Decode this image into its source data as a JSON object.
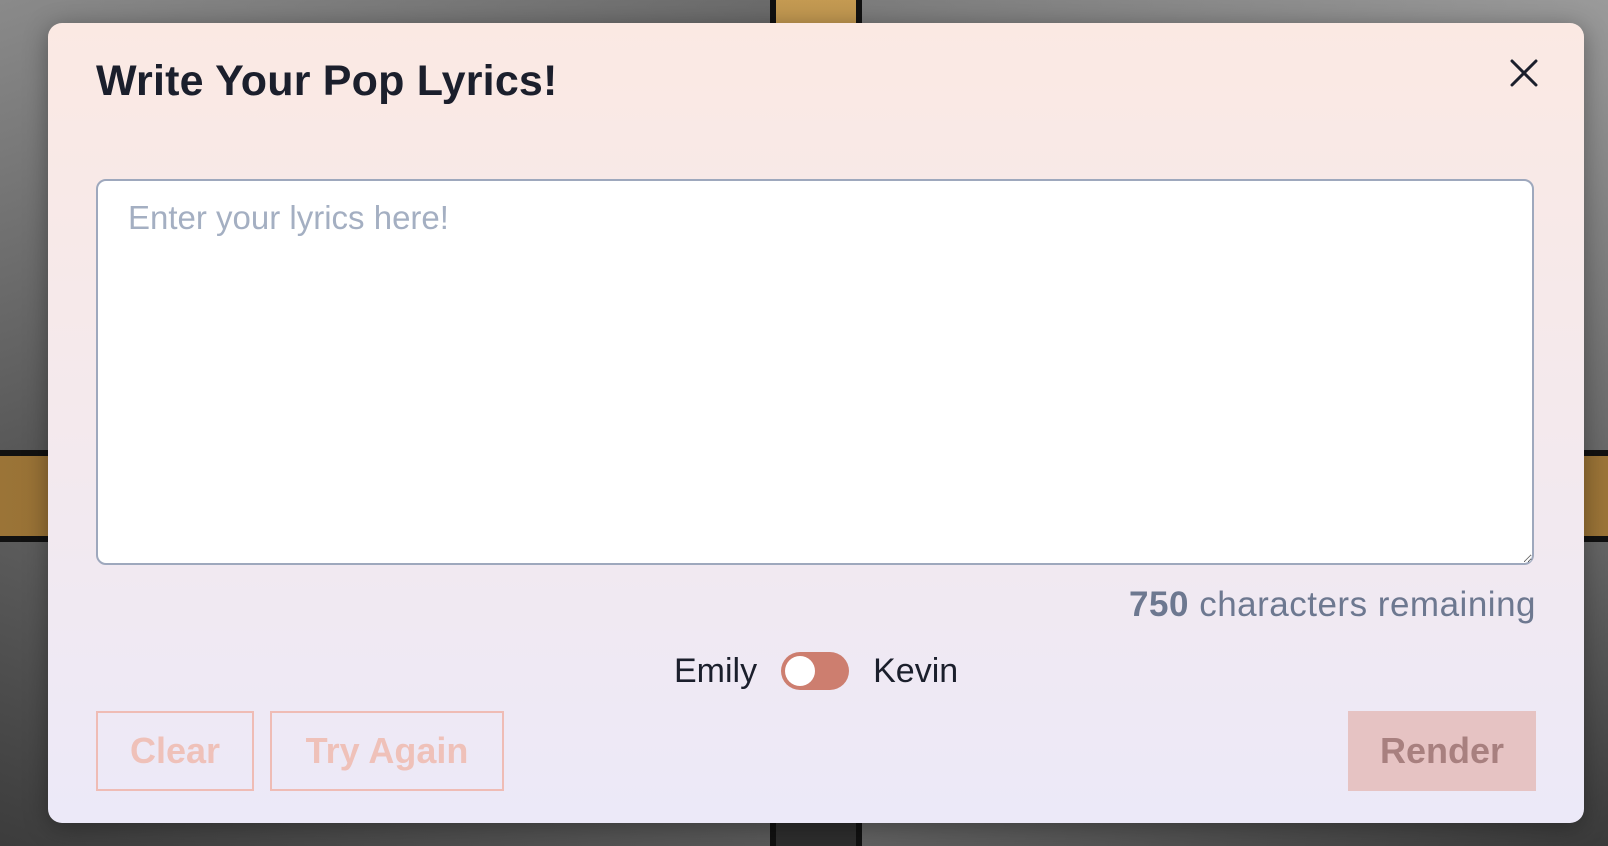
{
  "modal": {
    "title": "Write Your Pop Lyrics!",
    "close_icon": "close-icon"
  },
  "lyrics": {
    "placeholder": "Enter your lyrics here!",
    "value": ""
  },
  "counter": {
    "count": "750",
    "suffix": "characters remaining"
  },
  "voice_toggle": {
    "left_label": "Emily",
    "right_label": "Kevin",
    "selected": "Emily",
    "color": "#cd7e6f"
  },
  "buttons": {
    "clear": "Clear",
    "try_again": "Try Again",
    "render": "Render"
  },
  "colors": {
    "accent": "#cd7e6f",
    "outline_button": "#efbcb5",
    "render_bg": "#e6c3c3"
  }
}
